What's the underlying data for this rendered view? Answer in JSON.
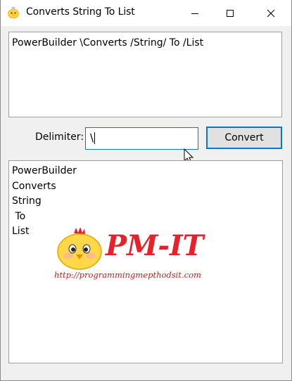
{
  "window": {
    "title": "Converts String To List"
  },
  "input": {
    "value": "PowerBuilder \\Converts /String/ To /List"
  },
  "delimiter": {
    "label": "Delimiter:",
    "value": "\\"
  },
  "convert_button": {
    "label": "Convert"
  },
  "output": {
    "lines": [
      "PowerBuilder",
      "Converts",
      "String",
      " To",
      "List"
    ]
  },
  "watermark": {
    "brand": "PM-IT",
    "url": "http://programmingmepthodsit.com"
  },
  "icons": {
    "app": "chick-icon",
    "minimize": "minimize-icon",
    "maximize": "maximize-icon",
    "close": "close-icon",
    "cursor": "mouse-pointer-icon"
  },
  "colors": {
    "focus_border": "#0078d7",
    "brand_red": "#e8202a",
    "button_face": "#e1e1e1"
  }
}
